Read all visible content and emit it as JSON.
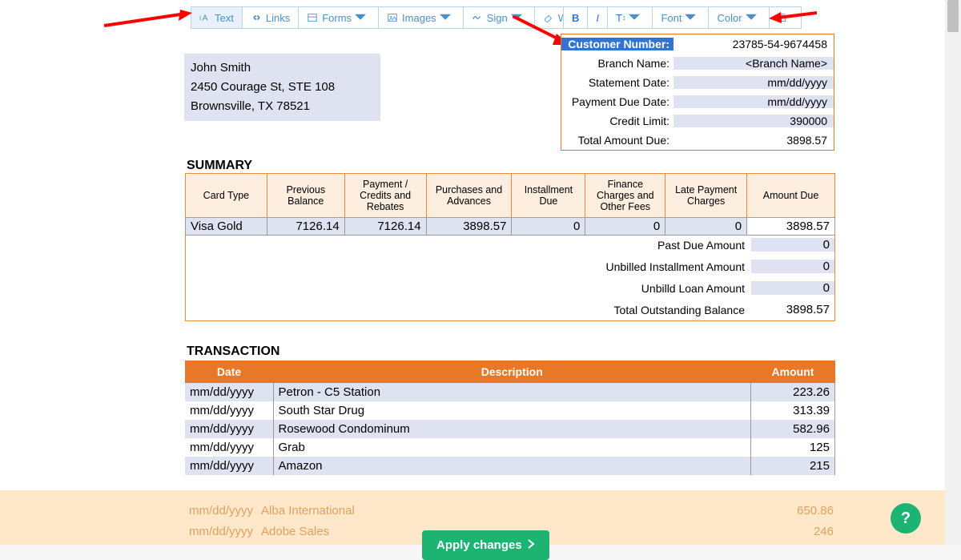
{
  "toolbar": {
    "text": "Text",
    "links": "Links",
    "forms": "Forms",
    "images": "Images",
    "sign": "Sign",
    "whiteout": "Whiteout",
    "bold": "B",
    "italic": "I",
    "textsize": "T",
    "font": "Font",
    "color": "Color"
  },
  "customer": {
    "name": "John Smith",
    "addr1": "2450 Courage St, STE 108",
    "addr2": "Brownsville, TX 78521"
  },
  "info": {
    "customer_number_label": "Customer Number:",
    "customer_number": "23785-54-9674458",
    "branch_label": "Branch Name:",
    "branch": "<Branch Name>",
    "stmt_date_label": "Statement Date:",
    "stmt_date": "mm/dd/yyyy",
    "due_date_label": "Payment Due Date:",
    "due_date": "mm/dd/yyyy",
    "credit_limit_label": "Credit Limit:",
    "credit_limit": "390000",
    "total_due_label": "Total Amount Due:",
    "total_due": "3898.57"
  },
  "summary": {
    "title": "SUMMARY",
    "headers": {
      "card_type": "Card Type",
      "prev_bal": "Previous Balance",
      "payment": "Payment / Credits and Rebates",
      "purchases": "Purchases and Advances",
      "installment": "Installment Due",
      "finance": "Finance Charges and Other Fees",
      "late": "Late Payment Charges",
      "amount_due": "Amount Due"
    },
    "row": {
      "card_type": "Visa Gold",
      "prev_bal": "7126.14",
      "payment": "7126.14",
      "purchases": "3898.57",
      "installment": "0",
      "finance": "0",
      "late": "0",
      "amount_due": "3898.57"
    },
    "footer": {
      "past_due_label": "Past Due Amount",
      "past_due": "0",
      "unbilled_inst_label": "Unbilled Installment Amount",
      "unbilled_inst": "0",
      "unbilled_loan_label": "Unbilld Loan Amount",
      "unbilled_loan": "0",
      "total_out_label": "Total Outstanding Balance",
      "total_out": "3898.57"
    }
  },
  "transaction": {
    "title": "TRANSACTION",
    "headers": {
      "date": "Date",
      "desc": "Description",
      "amount": "Amount"
    },
    "rows": [
      {
        "date": "mm/dd/yyyy",
        "desc": "Petron - C5 Station",
        "amt": "223.26"
      },
      {
        "date": "mm/dd/yyyy",
        "desc": "South Star Drug",
        "amt": "313.39"
      },
      {
        "date": "mm/dd/yyyy",
        "desc": "Rosewood Condominum",
        "amt": "582.96"
      },
      {
        "date": "mm/dd/yyyy",
        "desc": "Grab",
        "amt": "125"
      },
      {
        "date": "mm/dd/yyyy",
        "desc": "Amazon",
        "amt": "215"
      }
    ],
    "faded": [
      {
        "date": "mm/dd/yyyy",
        "desc": "Alba International",
        "amt": "650.86"
      },
      {
        "date": "mm/dd/yyyy",
        "desc": "Adobe Sales",
        "amt": "246"
      }
    ]
  },
  "apply_button": "Apply changes",
  "help": "?"
}
